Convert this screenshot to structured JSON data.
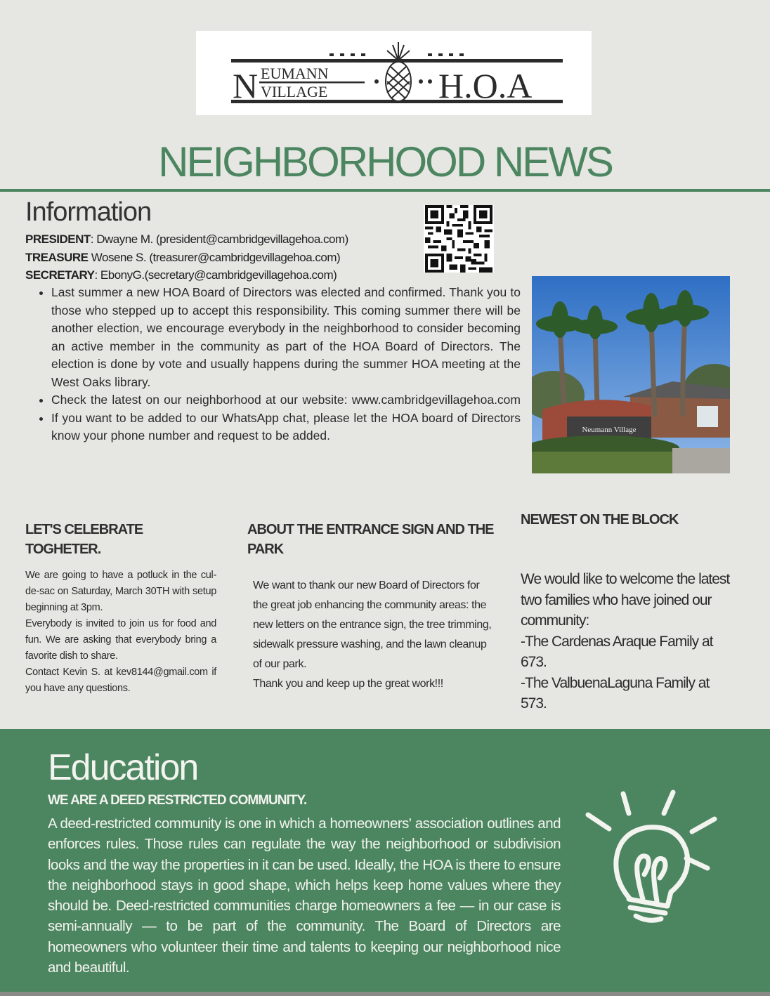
{
  "logo": {
    "line1_big": "N",
    "line1_top": "EUMANN",
    "line1_bottom": "VILLAGE",
    "right_text": "H.O.A"
  },
  "header": {
    "title": "NEIGHBORHOOD NEWS"
  },
  "information": {
    "heading": "Information",
    "contacts": [
      {
        "role": "PRESIDENT",
        "sep": ": ",
        "text": "Dwayne M. (president@cambridgevillagehoa.com)"
      },
      {
        "role": "TREASURE",
        "sep": " ",
        "text": "Wosene S. (treasurer@cambridgevillagehoa.com)"
      },
      {
        "role": "SECRETARY",
        "sep": ": ",
        "text": "EbonyG.(secretary@cambridgevillagehoa.com)"
      }
    ],
    "bullets": [
      "Last summer a new HOA Board of Directors was elected and confirmed. Thank you to those who stepped up to accept this responsibility. This coming summer there will be another election, we encourage everybody in the neighborhood to consider becoming an active member in the community as part of the HOA Board of Directors. The election is done by vote and usually happens during the summer HOA meeting at the West Oaks library.",
      "Check the latest on our neighborhood at our website: www.cambridgevillagehoa.com",
      " If you want to be added to our WhatsApp chat, please let the HOA board of Directors know your phone number and request to be added."
    ],
    "photo_sign_text": "Neumann Village"
  },
  "celebrate": {
    "title": "LET'S CELEBRATE TOGHETER.",
    "paragraphs": [
      "We are going to have a potluck in the cul-de-sac on Saturday, March 30TH with setup beginning at 3pm.",
      "Everybody is invited to join us for food and fun. We are asking that everybody bring a favorite dish to share.",
      "Contact Kevin S. at kev8144@gmail.com if you have any questions."
    ]
  },
  "entrance": {
    "title": "ABOUT THE ENTRANCE SIGN AND THE PARK",
    "paragraphs": [
      "We want to thank our new Board of Directors for the great job enhancing the community areas: the new letters on the entrance sign, the tree trimming, sidewalk pressure washing, and the lawn cleanup of our park.",
      "Thank you and keep up the great work!!!"
    ]
  },
  "newest": {
    "title": "NEWEST ON THE BLOCK",
    "lines": [
      "We would like to welcome the latest two families who have joined our community:",
      "-The Cardenas Araque Family at 673.",
      "-The ValbuenaLaguna Family at 573."
    ]
  },
  "education": {
    "heading": "Education",
    "subheading": "WE ARE A DEED RESTRICTED COMMUNITY.",
    "text": "A deed-restricted community is one in which a homeowners' association outlines and enforces rules. Those rules can regulate the way the neighborhood or subdivision looks and the way the properties in it can be used. Ideally, the HOA is there to ensure the neighborhood stays in good shape, which helps keep home values where they should be. Deed-restricted communities charge homeowners a fee — in our case is semi-annually — to be part of the community. The Board of Directors are homeowners who volunteer their time and talents to keeping our neighborhood nice and beautiful."
  },
  "colors": {
    "accent_green": "#4c8660",
    "page_bg": "#e6e6e3",
    "panel_text": "#f3f3ef"
  },
  "icons": [
    "pineapple-icon",
    "qr-code-icon",
    "lightbulb-icon"
  ]
}
